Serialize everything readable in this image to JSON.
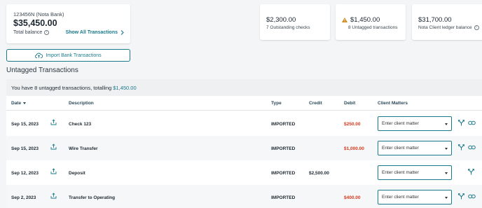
{
  "bank_card": {
    "account": "123456N (Nota Bank)",
    "amount": "$35,450.00",
    "sub_label": "Total balance",
    "link": "Show All Transactions"
  },
  "stats": [
    {
      "amount": "$2,300.00",
      "label": "7 Outstanding checks"
    },
    {
      "amount": "$1,450.00",
      "label": "8 Untagged transactions",
      "icon": "warning-icon"
    },
    {
      "amount": "$31,700.00",
      "label": "Nota Client ledger balance",
      "icon": "info-icon"
    }
  ],
  "import_button": "Import Bank Transactions",
  "section_title": "Untagged Transactions",
  "summary": {
    "text": "You have 8 untagged transactions, totalling",
    "total": "$1,450.00"
  },
  "columns": {
    "date": "Date",
    "description": "Description",
    "type": "Type",
    "credit": "Credit",
    "debit": "Debit",
    "matters": "Client Matters"
  },
  "rows": [
    {
      "date": "Sep 15, 2023",
      "description": "Check 123",
      "type": "IMPORTED",
      "credit": "",
      "debit": "$250.00",
      "matter_placeholder": "Enter client matter"
    },
    {
      "date": "Sep 15, 2023",
      "description": "Wire Transfer",
      "type": "IMPORTED",
      "credit": "",
      "debit": "$1,000.00",
      "matter_placeholder": "Enter client matter"
    },
    {
      "date": "Sep 12, 2023",
      "description": "Deposit",
      "type": "IMPORTED",
      "credit": "$2,500.00",
      "debit": "",
      "matter_placeholder": "Enter client matter"
    },
    {
      "date": "Sep 2, 2023",
      "description": "Transfer to Operating",
      "type": "IMPORTED",
      "credit": "",
      "debit": "$400.00",
      "matter_placeholder": "Enter client matter"
    }
  ],
  "colors": {
    "accent": "#1a7a8c",
    "debit": "#d5381c",
    "warning": "#c98a1a"
  }
}
